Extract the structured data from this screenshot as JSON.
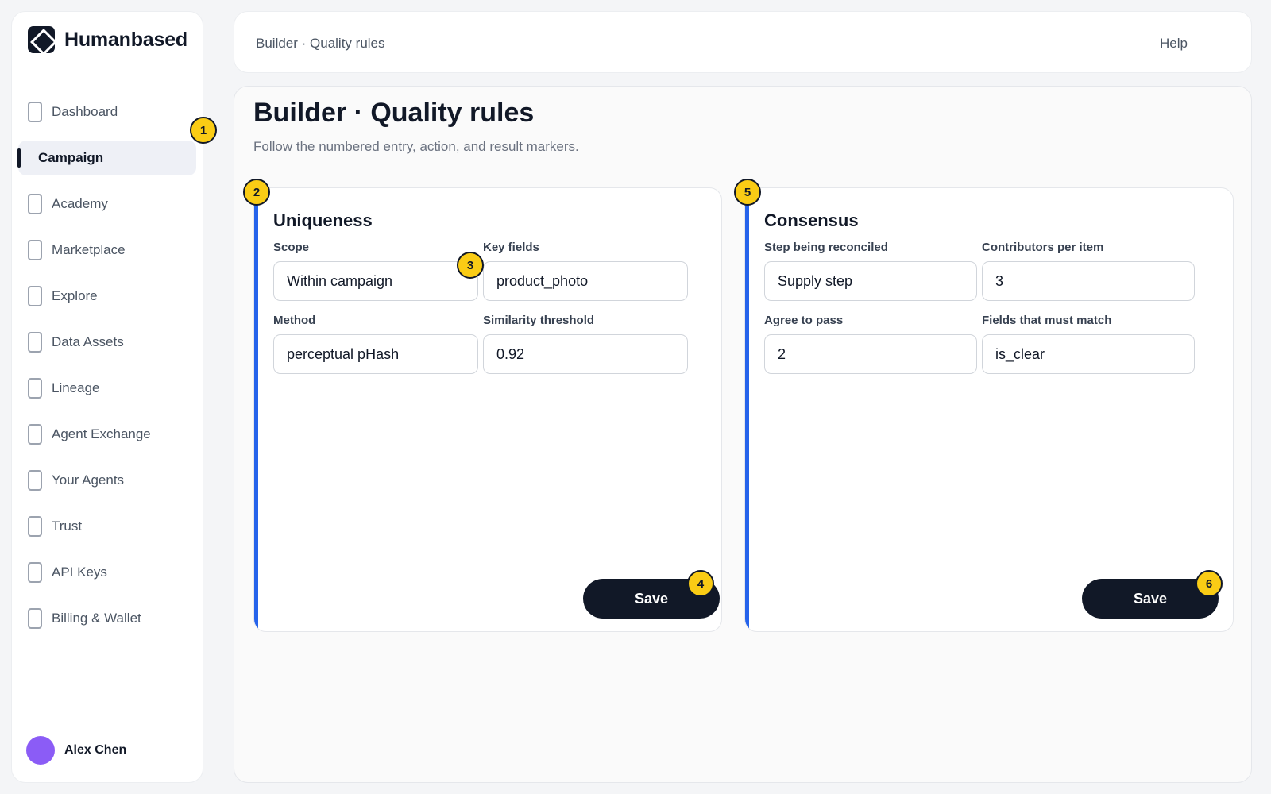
{
  "brand": {
    "name": "Humanbased"
  },
  "sidebar": {
    "items": [
      {
        "label": "Dashboard"
      },
      {
        "label": "Campaign"
      },
      {
        "label": "Academy"
      },
      {
        "label": "Marketplace"
      },
      {
        "label": "Explore"
      },
      {
        "label": "Data Assets"
      },
      {
        "label": "Lineage"
      },
      {
        "label": "Agent Exchange"
      },
      {
        "label": "Your Agents"
      },
      {
        "label": "Trust"
      },
      {
        "label": "API Keys"
      },
      {
        "label": "Billing & Wallet"
      }
    ],
    "active": "Campaign"
  },
  "user": {
    "name": "Alex Chen",
    "avatar_color": "#8b5cf6"
  },
  "header": {
    "breadcrumb": "Builder · Quality rules",
    "help_label": "Help"
  },
  "page": {
    "title": "Builder · Quality rules",
    "subtitle": "Follow the numbered entry, action, and result markers."
  },
  "uniqueness": {
    "title": "Uniqueness",
    "fields": [
      {
        "label": "Scope",
        "value": "Within campaign"
      },
      {
        "label": "Key fields",
        "value": "product_photo"
      },
      {
        "label": "Method",
        "value": "perceptual pHash"
      },
      {
        "label": "Similarity threshold",
        "value": "0.92"
      }
    ],
    "save_label": "Save"
  },
  "consensus": {
    "title": "Consensus",
    "fields": [
      {
        "label": "Step being reconciled",
        "value": "Supply step"
      },
      {
        "label": "Contributors per item",
        "value": "3"
      },
      {
        "label": "Agree to pass",
        "value": "2"
      },
      {
        "label": "Fields that must match",
        "value": "is_clear"
      }
    ],
    "save_label": "Save"
  },
  "markers": [
    "1",
    "2",
    "3",
    "4",
    "5",
    "6"
  ],
  "colors": {
    "accent": "#2563eb",
    "marker": "#facc15",
    "dark": "#111827"
  }
}
